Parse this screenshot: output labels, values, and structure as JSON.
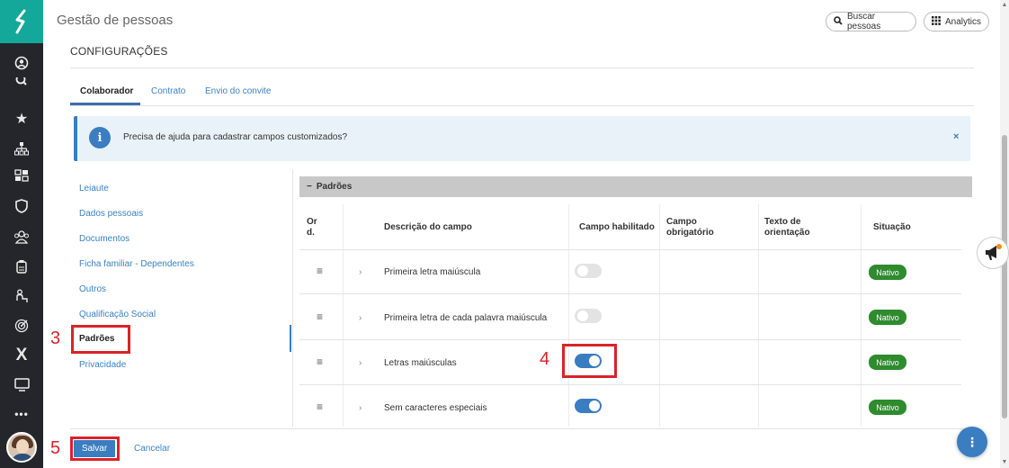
{
  "header": {
    "title": "Gestão de pessoas",
    "search_button": "Buscar pessoas",
    "analytics_button": "Analytics"
  },
  "page": {
    "title": "CONFIGURAÇÕES"
  },
  "tabs": [
    {
      "label": "Colaborador",
      "active": true
    },
    {
      "label": "Contrato",
      "active": false
    },
    {
      "label": "Envio do convite",
      "active": false
    }
  ],
  "info": {
    "icon_label": "i",
    "text": "Precisa de ajuda para cadastrar campos customizados?",
    "close": "×"
  },
  "nav": [
    {
      "label": "Leiaute"
    },
    {
      "label": "Dados pessoais"
    },
    {
      "label": "Documentos"
    },
    {
      "label": "Ficha familiar - Dependentes"
    },
    {
      "label": "Outros"
    },
    {
      "label": "Qualificação Social"
    },
    {
      "label": "Padrões",
      "active": true
    },
    {
      "label": "Privacidade"
    }
  ],
  "section": {
    "collapse_icon": "−",
    "title": "Padrões"
  },
  "table": {
    "headers": {
      "ord_1": "Or",
      "ord_2": "d.",
      "desc": "Descrição do campo",
      "enabled": "Campo habilitado",
      "required_1": "Campo",
      "required_2": "obrigatório",
      "guide_1": "Texto de",
      "guide_2": "orientação",
      "status": "Situação"
    },
    "rows": [
      {
        "desc": "Primeira letra maiúscula",
        "enabled": false,
        "status": "Nativo"
      },
      {
        "desc": "Primeira letra de cada palavra maiúscula",
        "enabled": false,
        "status": "Nativo"
      },
      {
        "desc": "Letras maiúsculas",
        "enabled": true,
        "status": "Nativo"
      },
      {
        "desc": "Sem caracteres especiais",
        "enabled": true,
        "status": "Nativo"
      }
    ]
  },
  "annotations": {
    "n3": "3",
    "n4": "4",
    "n5": "5"
  },
  "actions": {
    "save": "Salvar",
    "cancel": "Cancelar"
  },
  "fab": {
    "label": "⋮"
  },
  "colors": {
    "accent": "#3a7dc0",
    "logo": "#14a89a",
    "badge": "#2e8b2e",
    "annotation": "#d8232a"
  },
  "sidebar_icons": [
    "logo-icon",
    "user-circle-icon",
    "search-icon",
    "star-icon",
    "org-chart-icon",
    "people-icon",
    "shield-icon",
    "team-icon",
    "clipboard-icon",
    "person-desk-icon",
    "target-icon",
    "x-icon",
    "monitor-icon",
    "more-icon"
  ]
}
